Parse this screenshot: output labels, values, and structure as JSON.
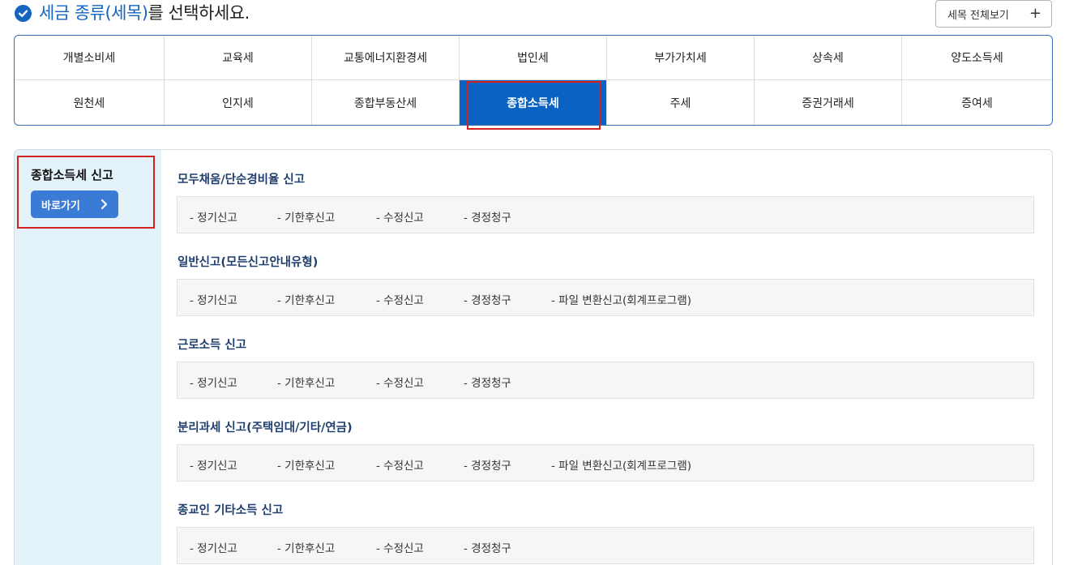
{
  "header": {
    "title_highlight": "세금 종류(세목)",
    "title_rest": "를 선택하세요.",
    "view_all_label": "세목 전체보기",
    "view_all_icon": "+"
  },
  "tabs": {
    "row1": [
      "개별소비세",
      "교육세",
      "교통에너지환경세",
      "법인세",
      "부가가치세",
      "상속세",
      "양도소득세"
    ],
    "row2": [
      "원천세",
      "인지세",
      "종합부동산세",
      "종합소득세",
      "주세",
      "증권거래세",
      "증여세"
    ],
    "active": "종합소득세"
  },
  "sidebar": {
    "title": "종합소득세 신고",
    "button_label": "바로가기"
  },
  "sections": [
    {
      "title": "모두채움/단순경비율 신고",
      "links": [
        "- 정기신고",
        "- 기한후신고",
        "- 수정신고",
        "- 경정청구"
      ]
    },
    {
      "title": "일반신고(모든신고안내유형)",
      "links": [
        "- 정기신고",
        "- 기한후신고",
        "- 수정신고",
        "- 경정청구",
        "- 파일 변환신고(회계프로그램)"
      ]
    },
    {
      "title": "근로소득 신고",
      "links": [
        "- 정기신고",
        "- 기한후신고",
        "- 수정신고",
        "- 경정청구"
      ]
    },
    {
      "title": "분리과세 신고(주택임대/기타/연금)",
      "links": [
        "- 정기신고",
        "- 기한후신고",
        "- 수정신고",
        "- 경정청구",
        "- 파일 변환신고(회계프로그램)"
      ]
    },
    {
      "title": "종교인 기타소득 신고",
      "links": [
        "- 정기신고",
        "- 기한후신고",
        "- 수정신고",
        "- 경정청구"
      ]
    }
  ],
  "colors": {
    "accent": "#1565c0",
    "active_tab": "#0a63c2",
    "sidebar_bg": "#e4f2fa",
    "button": "#3a7bd5",
    "highlight_box": "#d32222"
  }
}
